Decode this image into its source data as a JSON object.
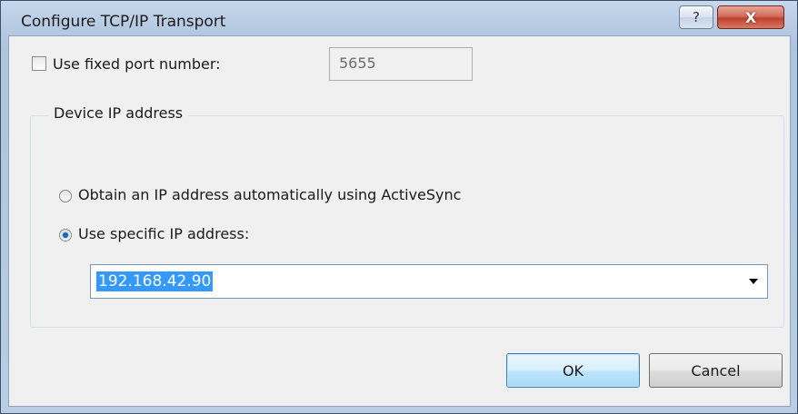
{
  "window": {
    "title": "Configure TCP/IP Transport",
    "help_glyph": "?",
    "close_glyph": "X"
  },
  "port": {
    "checkbox_label": "Use fixed port number:",
    "checked": false,
    "value": "5655"
  },
  "device_ip": {
    "group_label": "Device IP address",
    "option_auto_label": "Obtain an IP address automatically using ActiveSync",
    "option_specific_label": "Use specific IP address:",
    "selected_option": "specific",
    "ip_value": "192.168.42.90"
  },
  "buttons": {
    "ok_label": "OK",
    "cancel_label": "Cancel"
  },
  "colors": {
    "selection": "#3399ff",
    "radio_dot": "#1c63b8",
    "close_button": "#c0402d"
  }
}
